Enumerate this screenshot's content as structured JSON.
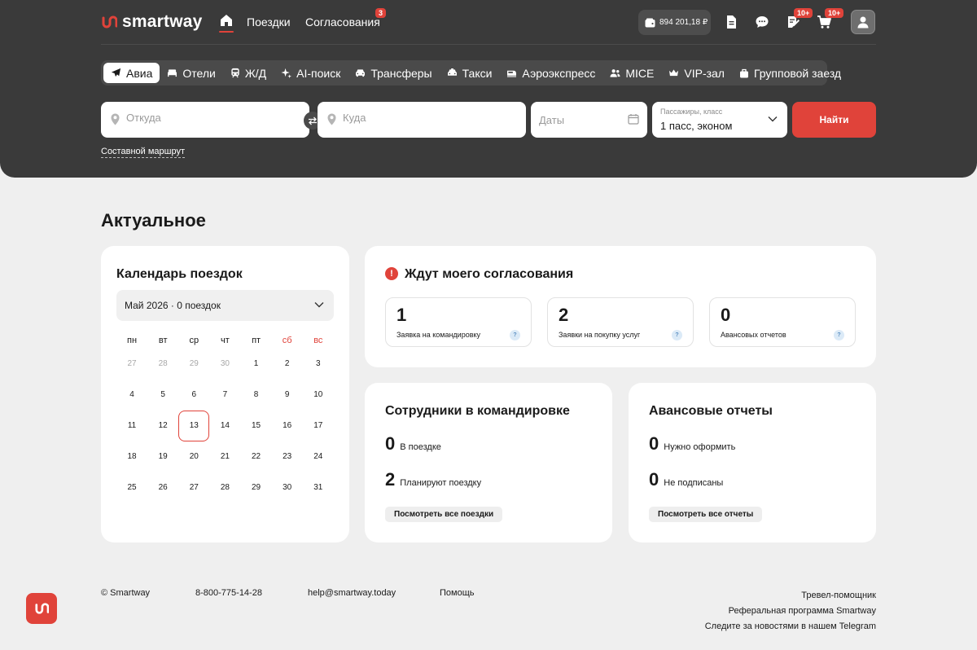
{
  "header": {
    "logo_text": "smartway",
    "nav": {
      "trips": "Поездки",
      "approvals": "Согласования",
      "approvals_badge": "3"
    },
    "balance": "894 201,18 ₽",
    "notes_badge": "10+",
    "cart_badge": "10+"
  },
  "service_tabs": [
    {
      "label": "Авиа",
      "icon": "plane-icon",
      "active": true
    },
    {
      "label": "Отели",
      "icon": "bed-icon"
    },
    {
      "label": "Ж/Д",
      "icon": "train-icon"
    },
    {
      "label": "AI-поиск",
      "icon": "sparkle-icon"
    },
    {
      "label": "Трансферы",
      "icon": "car-icon"
    },
    {
      "label": "Такси",
      "icon": "taxi-icon"
    },
    {
      "label": "Аэроэкспресс",
      "icon": "express-train-icon"
    },
    {
      "label": "MICE",
      "icon": "people-icon"
    },
    {
      "label": "VIP-зал",
      "icon": "crown-icon"
    },
    {
      "label": "Групповой заезд",
      "icon": "luggage-icon"
    }
  ],
  "search": {
    "from_placeholder": "Откуда",
    "to_placeholder": "Куда",
    "dates_placeholder": "Даты",
    "passengers_label": "Пассажиры, класс",
    "passengers_value": "1 пасс, эконом",
    "find_button": "Найти",
    "route_link": "Составной маршрут"
  },
  "main": {
    "section_title": "Актуальное",
    "calendar": {
      "title": "Календарь поездок",
      "month_select": "Май 2026 · 0 поездок",
      "weekdays": [
        "пн",
        "вт",
        "ср",
        "чт",
        "пт",
        "сб",
        "вс"
      ],
      "weeks": [
        [
          "27",
          "28",
          "29",
          "30",
          "1",
          "2",
          "3"
        ],
        [
          "4",
          "5",
          "6",
          "7",
          "8",
          "9",
          "10"
        ],
        [
          "11",
          "12",
          "13",
          "14",
          "15",
          "16",
          "17"
        ],
        [
          "18",
          "19",
          "20",
          "21",
          "22",
          "23",
          "24"
        ],
        [
          "25",
          "26",
          "27",
          "28",
          "29",
          "30",
          "31"
        ]
      ],
      "today": "13"
    },
    "approvals": {
      "title": "Ждут моего согласования",
      "alert": "!",
      "stats": [
        {
          "value": "1",
          "label": "Заявка на командировку",
          "help": "?"
        },
        {
          "value": "2",
          "label": "Заявки на покупку услуг",
          "help": "?"
        },
        {
          "value": "0",
          "label": "Авансовых отчетов",
          "help": "?"
        }
      ]
    },
    "employees": {
      "title": "Сотрудники в командировке",
      "in_trip_value": "0",
      "in_trip_label": "В поездке",
      "planning_value": "2",
      "planning_label": "Планируют поездку",
      "button": "Посмотреть все поездки"
    },
    "advance_reports": {
      "title": "Авансовые отчеты",
      "to_fill_value": "0",
      "to_fill_label": "Нужно оформить",
      "unsigned_value": "0",
      "unsigned_label": "Не подписаны",
      "button": "Посмотреть все отчеты"
    }
  },
  "footer": {
    "copyright": "© Smartway",
    "phone": "8-800-775-14-28",
    "email": "help@smartway.today",
    "help": "Помощь",
    "right_links": [
      "Тревел-помощник",
      "Реферальная программа Smartway",
      "Следите за новостями в нашем Telegram"
    ]
  },
  "colors": {
    "accent": "#e0433a",
    "header_bg": "#3a3a3a",
    "page_bg": "#efefef"
  }
}
